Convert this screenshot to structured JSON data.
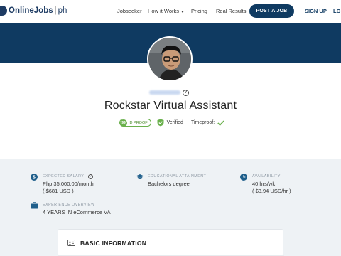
{
  "nav": {
    "logo_main": "OnlineJobs",
    "logo_sep": "|",
    "logo_suffix": "ph",
    "links": [
      "Jobseeker",
      "How it Works",
      "Pricing",
      "Real Results"
    ],
    "post_job": "POST A JOB",
    "signup": "SIGN UP",
    "login": "LO"
  },
  "profile": {
    "title": "Rockstar Virtual Assistant",
    "help": "?",
    "id_score": "99",
    "id_label": "ID PROOF",
    "verified": "Verified",
    "timeproof": "Timeproof:"
  },
  "stats": {
    "salary": {
      "label": "EXPECTED SALARY",
      "help": "?",
      "line1": "Php 35,000.00/month",
      "line2": "( $681 USD )",
      "icon": "dollar-icon"
    },
    "education": {
      "label": "EDUCATIONAL ATTAINMENT",
      "line1": "Bachelors degree",
      "icon": "graduation-cap-icon"
    },
    "availability": {
      "label": "AVAILABILITY",
      "line1": "40 hrs/wk",
      "line2": "( $3.94 USD/hr )",
      "icon": "clock-icon"
    },
    "experience": {
      "label": "EXPERIENCE OVERVIEW",
      "line1": "4 YEARS IN eCommerce VA",
      "icon": "briefcase-icon"
    }
  },
  "basic_info": {
    "title": "BASIC INFORMATION",
    "icon": "id-card-icon"
  },
  "colors": {
    "brand": "#0f3a61",
    "accent_green": "#6ab04c",
    "stat_icon": "#1f5f8b",
    "info_bg": "#eef2f5"
  }
}
